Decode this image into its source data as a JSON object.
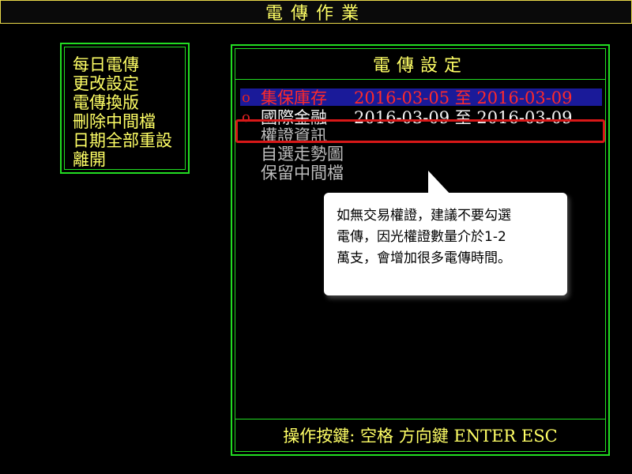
{
  "window": {
    "title": "電傳作業"
  },
  "menu": {
    "items": [
      {
        "label": "每日電傳"
      },
      {
        "label": "更改設定"
      },
      {
        "label": "電傳換版"
      },
      {
        "label": "刪除中間檔"
      },
      {
        "label": "日期全部重設"
      },
      {
        "label": "離開"
      }
    ]
  },
  "settings_panel": {
    "title": "電傳設定",
    "items": [
      {
        "marker": "o",
        "label": "集保庫存",
        "date_range": "2016-03-05 至 2016-03-09",
        "selected": true
      },
      {
        "marker": "o",
        "label": "國際金融",
        "date_range": "2016-03-09 至 2016-03-09",
        "selected": false
      },
      {
        "marker": "",
        "label": "權證資訊",
        "date_range": "",
        "selected": false
      },
      {
        "marker": "",
        "label": "自選走勢圖",
        "date_range": "",
        "selected": false
      },
      {
        "marker": "",
        "label": "保留中間檔",
        "date_range": "",
        "selected": false
      }
    ],
    "footer": "操作按鍵: 空格 方向鍵 ENTER ESC"
  },
  "callout": {
    "lines": [
      "如無交易權證，建議不要勾選",
      "電傳，因光權證數量介於1-2",
      "萬支，會增加很多電傳時間。"
    ]
  },
  "colors": {
    "background": "#000000",
    "menu_text": "#ffff66",
    "border": "#22dd22",
    "selected_row": "#1a1a99",
    "selected_text": "#ff2a2a",
    "highlight_border": "#d81818"
  }
}
